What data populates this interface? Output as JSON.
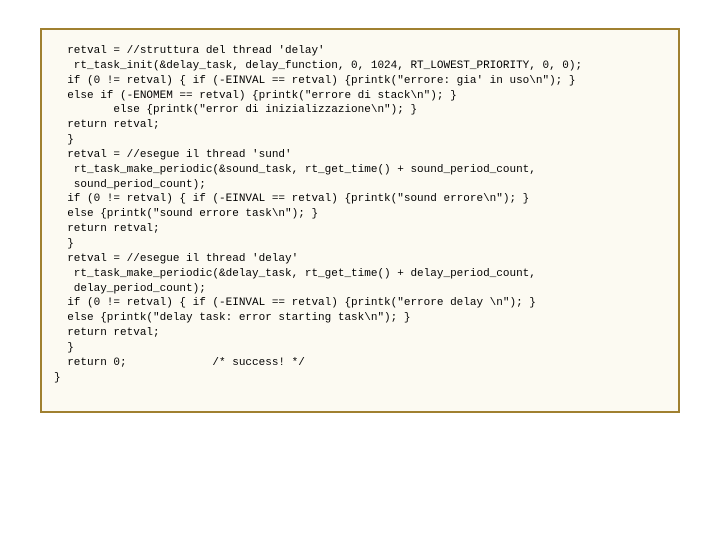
{
  "code": {
    "block1": {
      "l1": "  retval = //struttura del thread 'delay'",
      "l2": "   rt_task_init(&delay_task, delay_function, 0, 1024, RT_LOWEST_PRIORITY, 0, 0);",
      "l3": "  if (0 != retval) { if (-EINVAL == retval) {printk(\"errore: gia' in uso\\n\"); }",
      "l4": "  else if (-ENOMEM == retval) {printk(\"errore di stack\\n\"); }",
      "l5": "         else {printk(\"error di inizializzazione\\n\"); }",
      "l6": "  return retval;",
      "l7": "  }"
    },
    "block2": {
      "l1": "  retval = //esegue il thread 'sund'",
      "l2": "   rt_task_make_periodic(&sound_task, rt_get_time() + sound_period_count,",
      "l3": "   sound_period_count);",
      "l4": "  if (0 != retval) { if (-EINVAL == retval) {printk(\"sound errore\\n\"); }",
      "l5": "  else {printk(\"sound errore task\\n\"); }",
      "l6": "  return retval;",
      "l7": "  }"
    },
    "block3": {
      "l1": "  retval = //esegue il thread 'delay'",
      "l2": "   rt_task_make_periodic(&delay_task, rt_get_time() + delay_period_count,",
      "l3": "   delay_period_count);",
      "l4": "  if (0 != retval) { if (-EINVAL == retval) {printk(\"errore delay \\n\"); }",
      "l5": "  else {printk(\"delay task: error starting task\\n\"); }",
      "l6": "  return retval;",
      "l7": "  }",
      "l8": "  return 0;             /* success! */",
      "l9": "}"
    }
  }
}
